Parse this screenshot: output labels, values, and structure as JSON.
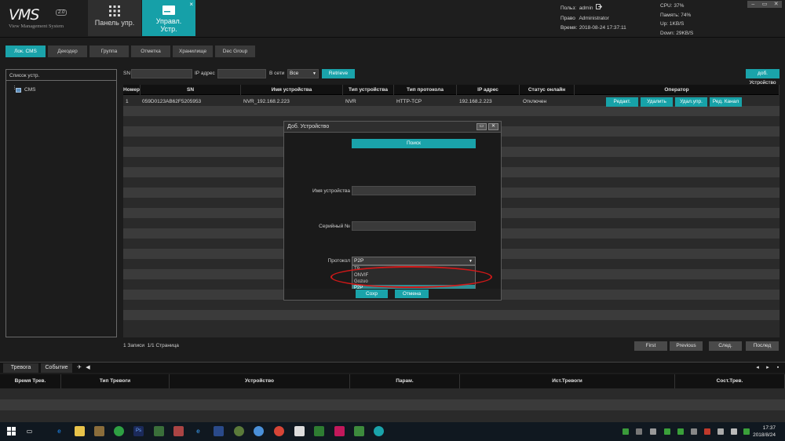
{
  "app": {
    "logo": "VMS",
    "version": "2.0",
    "subtitle": "View Management System"
  },
  "main_tabs": [
    {
      "label_line1": "Панель упр.",
      "label_line2": ""
    },
    {
      "label_line1": "Управл.",
      "label_line2": "Устр.",
      "close": "×"
    }
  ],
  "session": {
    "user_label": "Польз:",
    "user_value": "admin",
    "right_label": "Право",
    "right_value": "Administrator",
    "time_label": "Время:",
    "time_value": "2018-08-24 17:37:11"
  },
  "stats": {
    "cpu": "CPU: 37%",
    "memory": "Память: 74%",
    "up": "Up: 1KB/S",
    "down": "Down: 29KB/S"
  },
  "window_controls": [
    "‒",
    "▭",
    "✕"
  ],
  "sub_tabs": [
    "Лок. CMS",
    "Декодер",
    "Группа",
    "Отметка",
    "Хранилище",
    "Dec Group"
  ],
  "tree": {
    "title": "Список устр.",
    "node": "CMS"
  },
  "filter": {
    "sn_label": "SN",
    "ip_label": "IP адрес",
    "net_label": "В сети",
    "net_value": "Все",
    "retrieve": "Retrieve",
    "add_device": "доб. Устройство"
  },
  "table": {
    "headers": [
      "Номер",
      "SN",
      "Имя устройства",
      "Тип устройства",
      "Тип протокола",
      "IP адрес",
      "Статус онлайн",
      "Оператор"
    ],
    "row": {
      "num": "1",
      "sn": "059D0123AB62F5205953",
      "name": "NVR_192.168.2.223",
      "type": "NVR",
      "protocol": "HTTP-TCP",
      "ip": "192.168.2.223",
      "status": "Отключен"
    },
    "actions": [
      "Редакт.",
      "Удалить",
      "Удал.упр.",
      "Ред. Канал"
    ]
  },
  "pagination": {
    "records": "1 Записи",
    "pages": "1/1 Страница",
    "first": "First",
    "previous": "Previous",
    "next": "След.",
    "last": "Послед"
  },
  "dialog": {
    "title": "Доб. Устройство",
    "search": "Поиск",
    "name_label": "Имя устройства",
    "serial_label": "Серийный №",
    "protocol_label": "Протокол",
    "protocol_value": "P2P",
    "options": [
      "T9",
      "ONVIF",
      "Gozuo"
    ],
    "options_selected": "P2P",
    "save": "Сохр",
    "cancel": "Отмена"
  },
  "alarm": {
    "tab_alarm": "Тревога",
    "tab_event": "Событие",
    "headers": [
      "Время Трев.",
      "Тип Тревоги",
      "Устройство",
      "Парам.",
      "Ист.Тревоги",
      "Сост.Трев."
    ]
  },
  "taskbar": {
    "time": "17:37",
    "date": "2018/8/24"
  },
  "colors": {
    "accent": "#1aa3aa",
    "highlight_ring": "#d01818"
  }
}
